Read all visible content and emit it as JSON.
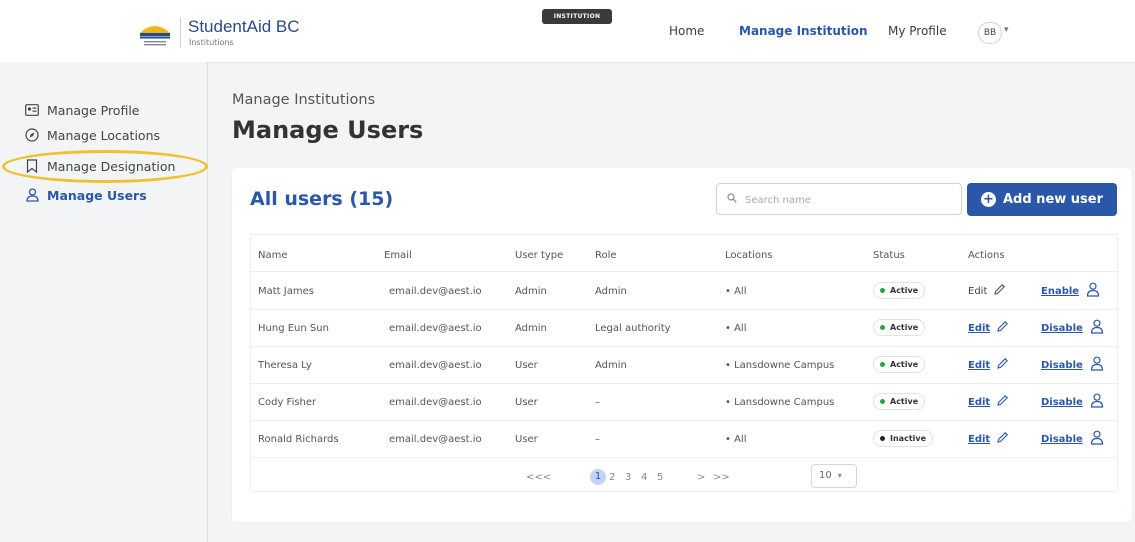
{
  "header": {
    "brand_title": "StudentAid BC",
    "brand_sub": "Institutions",
    "env_badge": "INSTITUTION",
    "nav": [
      {
        "label": "Home"
      },
      {
        "label": "Manage Institution",
        "active": true
      },
      {
        "label": "My Profile"
      }
    ],
    "avatar": "BB",
    "accent": "#2b57a8"
  },
  "sidebar": {
    "items": [
      {
        "label": "Manage Profile",
        "icon": "profile-card-icon"
      },
      {
        "label": "Manage Locations",
        "icon": "compass-icon"
      },
      {
        "label": "Manage Designation",
        "icon": "bookmark-icon"
      },
      {
        "label": "Manage Users",
        "icon": "user-icon",
        "active": true
      }
    ],
    "highlight_color": "#f0c030"
  },
  "page": {
    "breadcrumb": "Manage Institutions",
    "title": "Manage Users"
  },
  "card": {
    "title": "All users (15)",
    "search_placeholder": "Search name",
    "add_button": "Add new user",
    "columns": [
      "Name",
      "Email",
      "User type",
      "Role",
      "Locations",
      "Status",
      "Actions"
    ],
    "rows": [
      {
        "name": "Matt James",
        "email": "email.dev@aest.io",
        "type": "Admin",
        "role": "Admin",
        "location": "• All",
        "status": "Active",
        "edit": "Edit",
        "toggle": "Enable"
      },
      {
        "name": "Hung Eun Sun",
        "email": "email.dev@aest.io",
        "type": "Admin",
        "role": "Legal authority",
        "location": "• All",
        "status": "Active",
        "edit": "Edit",
        "toggle": "Disable"
      },
      {
        "name": "Theresa Ly",
        "email": "email.dev@aest.io",
        "type": "User",
        "role": "Admin",
        "location": "• Lansdowne Campus",
        "status": "Active",
        "edit": "Edit",
        "toggle": "Disable"
      },
      {
        "name": "Cody Fisher",
        "email": "email.dev@aest.io",
        "type": "User",
        "role": "–",
        "location": "• Lansdowne Campus",
        "status": "Active",
        "edit": "Edit",
        "toggle": "Disable"
      },
      {
        "name": "Ronald Richards",
        "email": "email.dev@aest.io",
        "type": "User",
        "role": "–",
        "location": "• All",
        "status": "Inactive",
        "edit": "Edit",
        "toggle": "Disable"
      }
    ],
    "status_colors": {
      "Active": "#2e9e4f",
      "Inactive": "#222222"
    },
    "pagination": {
      "first": "<<",
      "prev": "<",
      "pages": [
        "1",
        "2",
        "3",
        "4",
        "5"
      ],
      "current": "1",
      "next": ">",
      "last": ">>",
      "per_page": "10"
    }
  }
}
